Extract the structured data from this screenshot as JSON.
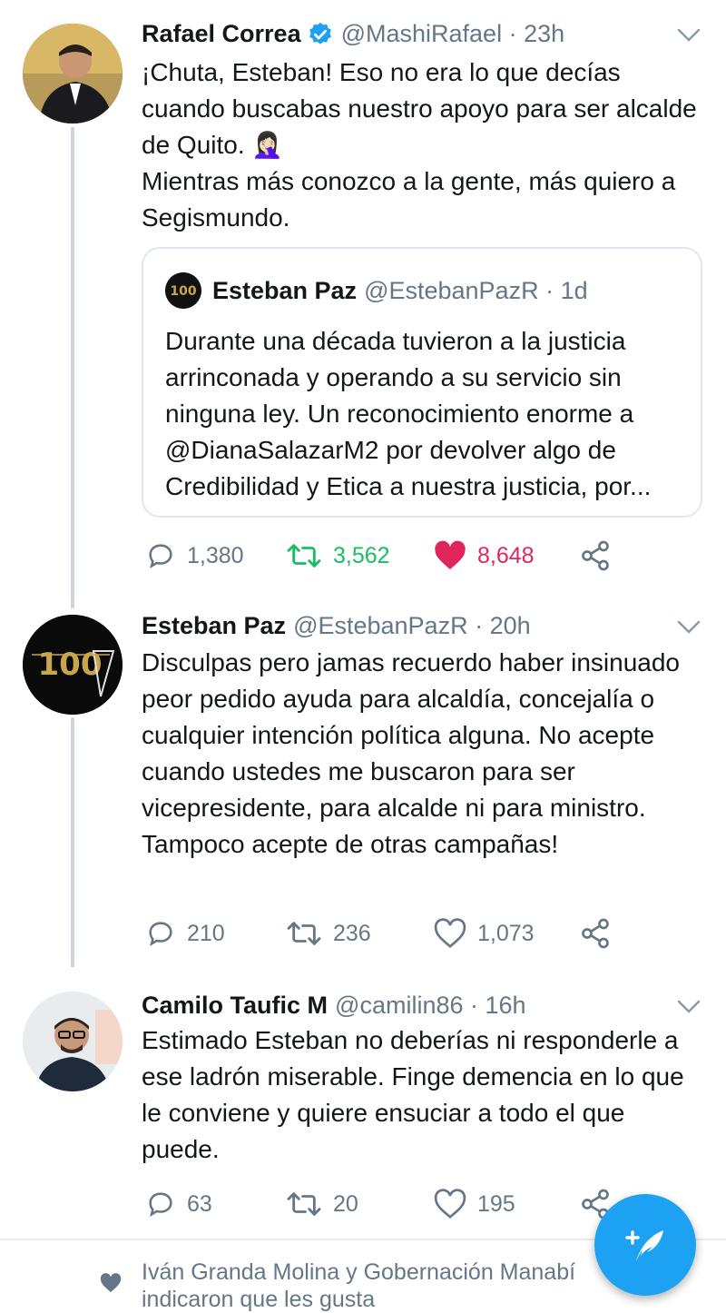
{
  "tweets": [
    {
      "name": "Rafael Correa",
      "handle": "@MashiRafael · 23h",
      "text_lines": [
        "¡Chuta, Esteban! Eso no era lo que decías cuando buscabas nuestro apoyo para ser alcalde de Quito. 🤦🏻‍♀️",
        "Mientras más conozco a la gente, más quiero a Segismundo."
      ],
      "quoted": {
        "name": "Esteban Paz",
        "handle": "@EstebanPazR · 1d",
        "text": "Durante una década tuvieron a la justicia arrinconada y operando a su servicio sin ninguna ley. Un reconocimiento enorme a @DianaSalazarM2 por devolver algo de Credibilidad y Etica a nuestra justicia, por..."
      },
      "replies": "1,380",
      "retweets": "3,562",
      "likes": "8,648"
    },
    {
      "name": "Esteban Paz",
      "handle": "@EstebanPazR · 20h",
      "text": "Disculpas pero jamas recuerdo haber insinuado peor pedido ayuda para alcaldía, concejalía o cualquier intención política alguna. No acepte cuando ustedes me buscaron para ser vicepresidente, para alcalde ni para ministro. Tampoco acepte de otras campañas!",
      "replies": "210",
      "retweets": "236",
      "likes": "1,073"
    },
    {
      "name": "Camilo Taufic M",
      "handle": "@camilin86 · 16h",
      "text": "Estimado Esteban no deberías ni responderle a ese ladrón miserable. Finge demencia en lo que le conviene y quiere ensuciar a todo el que puede.",
      "replies": "63",
      "retweets": "20",
      "likes": "195"
    }
  ],
  "likes_notice": "Iván Granda Molina y Gobernación Manabí indicaron que les gusta",
  "colors": {
    "accent": "#1da1f2",
    "retweeted": "#17bf63",
    "liked": "#e0245e",
    "muted": "#657786"
  },
  "icons": [
    "verified-icon",
    "caret-down-icon",
    "reply-icon",
    "retweet-icon",
    "like-icon",
    "share-icon",
    "compose-icon"
  ]
}
